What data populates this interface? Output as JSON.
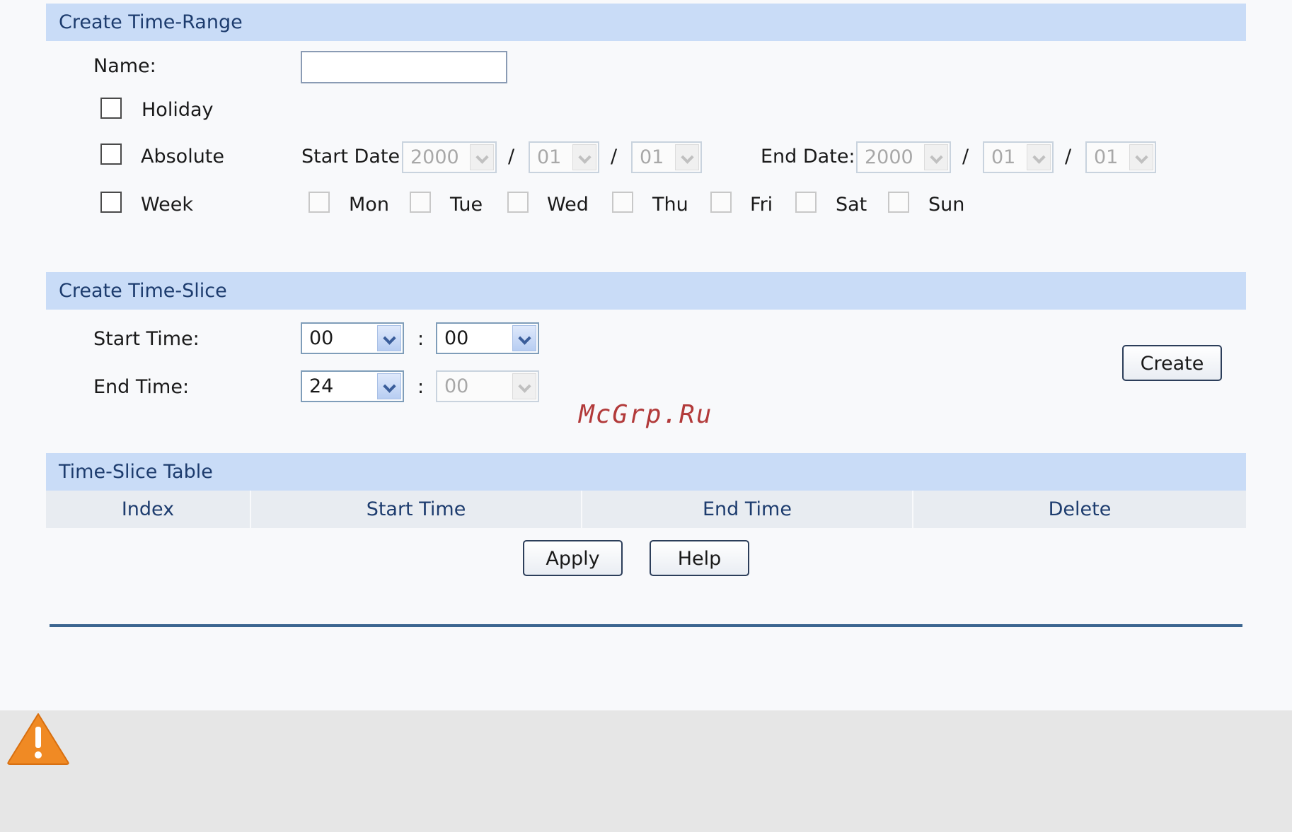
{
  "range_section": {
    "title": "Create Time-Range",
    "name_label": "Name:",
    "name_value": "",
    "holiday_label": "Holiday",
    "absolute_label": "Absolute",
    "week_label": "Week",
    "start_date_label": "Start Date:",
    "end_date_label": "End Date:",
    "date_separator": "/",
    "start_date": {
      "year": "2000",
      "month": "01",
      "day": "01"
    },
    "end_date": {
      "year": "2000",
      "month": "01",
      "day": "01"
    },
    "days": [
      "Mon",
      "Tue",
      "Wed",
      "Thu",
      "Fri",
      "Sat",
      "Sun"
    ]
  },
  "slice_section": {
    "title": "Create Time-Slice",
    "start_time_label": "Start Time:",
    "end_time_label": "End Time:",
    "time_separator": ":",
    "start_hour": "00",
    "start_minute": "00",
    "end_hour": "24",
    "end_minute": "00",
    "create_label": "Create"
  },
  "table_section": {
    "title": "Time-Slice Table",
    "columns": [
      "Index",
      "Start Time",
      "End Time",
      "Delete"
    ]
  },
  "actions": {
    "apply_label": "Apply",
    "help_label": "Help"
  },
  "watermark": "McGrp.Ru",
  "colors": {
    "header_bg": "#c9dcf7",
    "header_text": "#1d3c6e",
    "divider": "#3c6690",
    "warning": "#f08a24"
  },
  "icons": {
    "warning": "warning-triangle-icon"
  }
}
